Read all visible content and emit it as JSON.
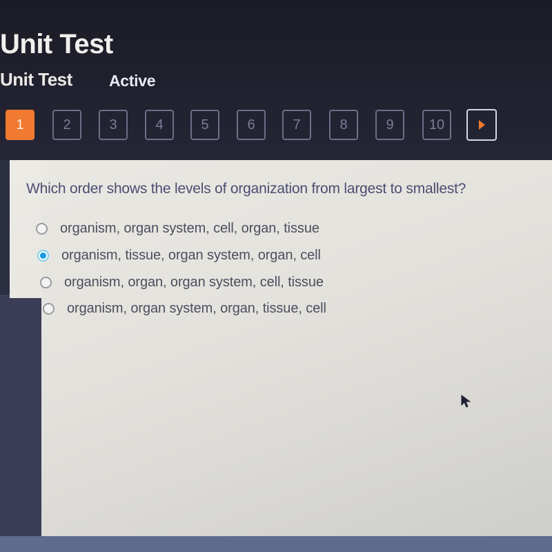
{
  "header": {
    "title": "Unit Test",
    "subtitle": "Unit Test",
    "status": "Active"
  },
  "navigation": {
    "questions": [
      {
        "label": "1",
        "state": "current"
      },
      {
        "label": "2",
        "state": "unanswered"
      },
      {
        "label": "3",
        "state": "unanswered"
      },
      {
        "label": "4",
        "state": "unanswered"
      },
      {
        "label": "5",
        "state": "unanswered"
      },
      {
        "label": "6",
        "state": "unanswered"
      },
      {
        "label": "7",
        "state": "unanswered"
      },
      {
        "label": "8",
        "state": "unanswered"
      },
      {
        "label": "9",
        "state": "unanswered"
      },
      {
        "label": "10",
        "state": "unanswered"
      }
    ],
    "next_icon": "play-arrow-icon"
  },
  "question": {
    "number": 1,
    "text": "Which order shows the levels of organization from largest to smallest?",
    "options": [
      {
        "label": "organism, organ system, cell, organ, tissue",
        "selected": false
      },
      {
        "label": "organism, tissue, organ system, organ, cell",
        "selected": true
      },
      {
        "label": "organism, organ, organ system, cell, tissue",
        "selected": false
      },
      {
        "label": "organism, organ system, organ, tissue, cell",
        "selected": false
      }
    ]
  },
  "colors": {
    "accent": "#f07a30",
    "selected_radio": "#1a9ae0",
    "question_text": "#4a4d72"
  }
}
